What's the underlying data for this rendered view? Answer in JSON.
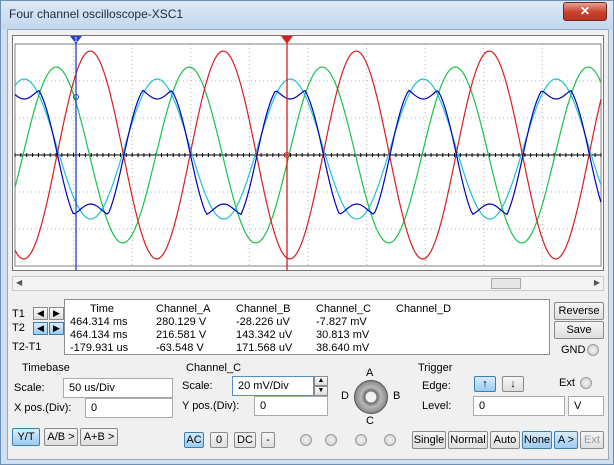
{
  "window": {
    "title": "Four channel oscilloscope-XSC1",
    "close_icon": "close-icon (x)"
  },
  "colors": {
    "channel_a": "#0000c0",
    "channel_b": "#19c24a",
    "channel_c": "#d81e1e",
    "channel_d": "#20c0d0",
    "cursor_t1": "#2040d0",
    "cursor_t2": "#d81e1e",
    "accent": "#3c7fb1"
  },
  "cursors": {
    "t1_label": "1",
    "t2_label": "2"
  },
  "readout": {
    "headers": [
      "Time",
      "Channel_A",
      "Channel_B",
      "Channel_C",
      "Channel_D"
    ],
    "rows": [
      {
        "label": "T1",
        "time": "464.314 ms",
        "a": "280.129 V",
        "b": "-28.226 uV",
        "c": "-7.827 mV",
        "d": ""
      },
      {
        "label": "T2",
        "time": "464.134 ms",
        "a": "216.581 V",
        "b": "143.342 uV",
        "c": "30.813 mV",
        "d": ""
      },
      {
        "label": "T2-T1",
        "time": "-179.931 us",
        "a": "-63.548 V",
        "b": "171.568 uV",
        "c": "38.640 mV",
        "d": ""
      }
    ]
  },
  "buttons": {
    "reverse": "Reverse",
    "save": "Save",
    "gnd": "GND"
  },
  "timebase": {
    "title": "Timebase",
    "scale_label": "Scale:",
    "scale_value": "50 us/Div",
    "xpos_label": "X pos.(Div):",
    "xpos_value": "0",
    "modes": [
      "Y/T",
      "A/B >",
      "A+B >"
    ]
  },
  "channel": {
    "title": "Channel_C",
    "scale_label": "Scale:",
    "scale_value": "20 mV/Div",
    "ypos_label": "Y pos.(Div):",
    "ypos_value": "0",
    "coupling": [
      "AC",
      "0",
      "DC",
      "-"
    ],
    "selector_labels": [
      "A",
      "B",
      "C",
      "D"
    ]
  },
  "trigger": {
    "title": "Trigger",
    "edge_label": "Edge:",
    "level_label": "Level:",
    "level_value": "0",
    "level_unit": "V",
    "ext_label": "Ext",
    "modes": [
      "Single",
      "Normal",
      "Auto",
      "None",
      "A >",
      "Ext"
    ]
  }
}
